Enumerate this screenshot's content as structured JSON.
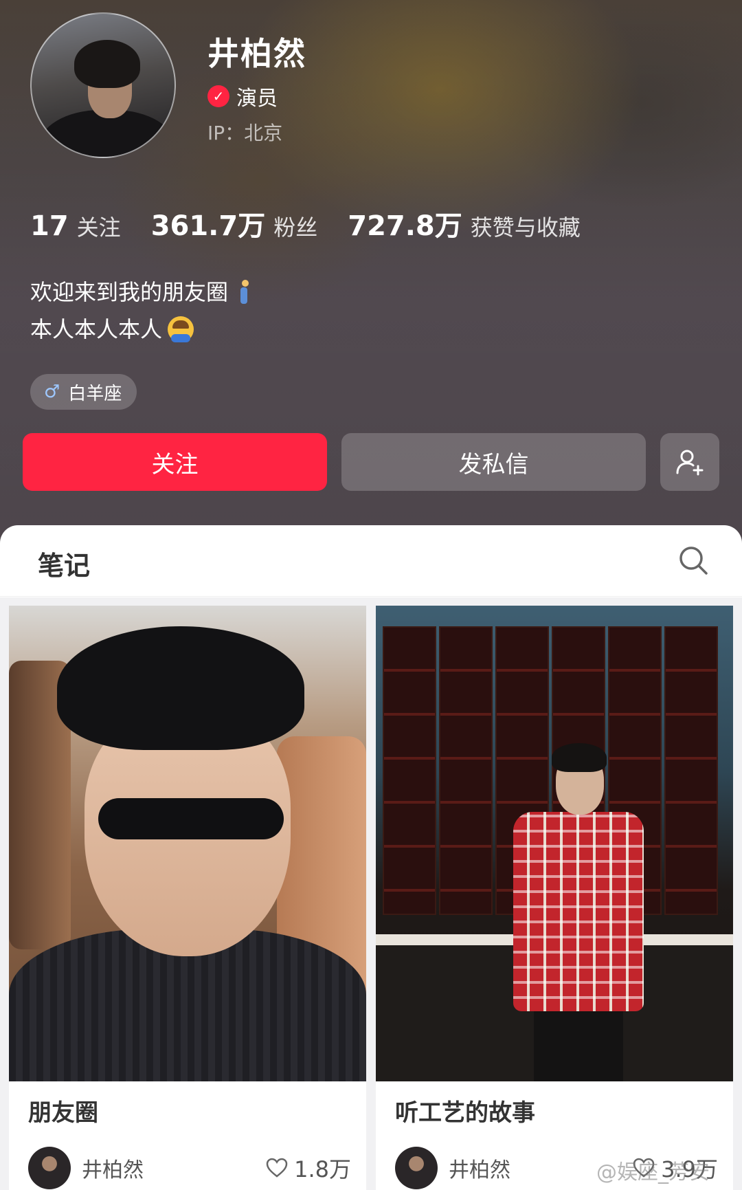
{
  "profile": {
    "name": "井柏然",
    "verified_label": "演员",
    "ip": "IP：北京",
    "stats": [
      {
        "num": "17",
        "label": "关注"
      },
      {
        "num": "361.7万",
        "label": "粉丝"
      },
      {
        "num": "727.8万",
        "label": "获赞与收藏"
      }
    ],
    "bio": [
      "欢迎来到我的朋友圈",
      "本人本人本人"
    ],
    "tag": "白羊座"
  },
  "actions": {
    "follow": "关注",
    "message": "发私信"
  },
  "panel": {
    "title": "笔记"
  },
  "notes": [
    {
      "title": "朋友圈",
      "author": "井柏然",
      "likes": "1.8万"
    },
    {
      "title": "听工艺的故事",
      "author": "井柏然",
      "likes": "3.9万"
    }
  ],
  "watermark": "@娱座_芳安",
  "colors": {
    "accent": "#ff2442"
  },
  "icons": {
    "verified": "check-circle-icon",
    "tag": "male-icon",
    "add_friend": "person-add-icon",
    "search": "search-icon",
    "likes": "heart-outline-icon"
  }
}
